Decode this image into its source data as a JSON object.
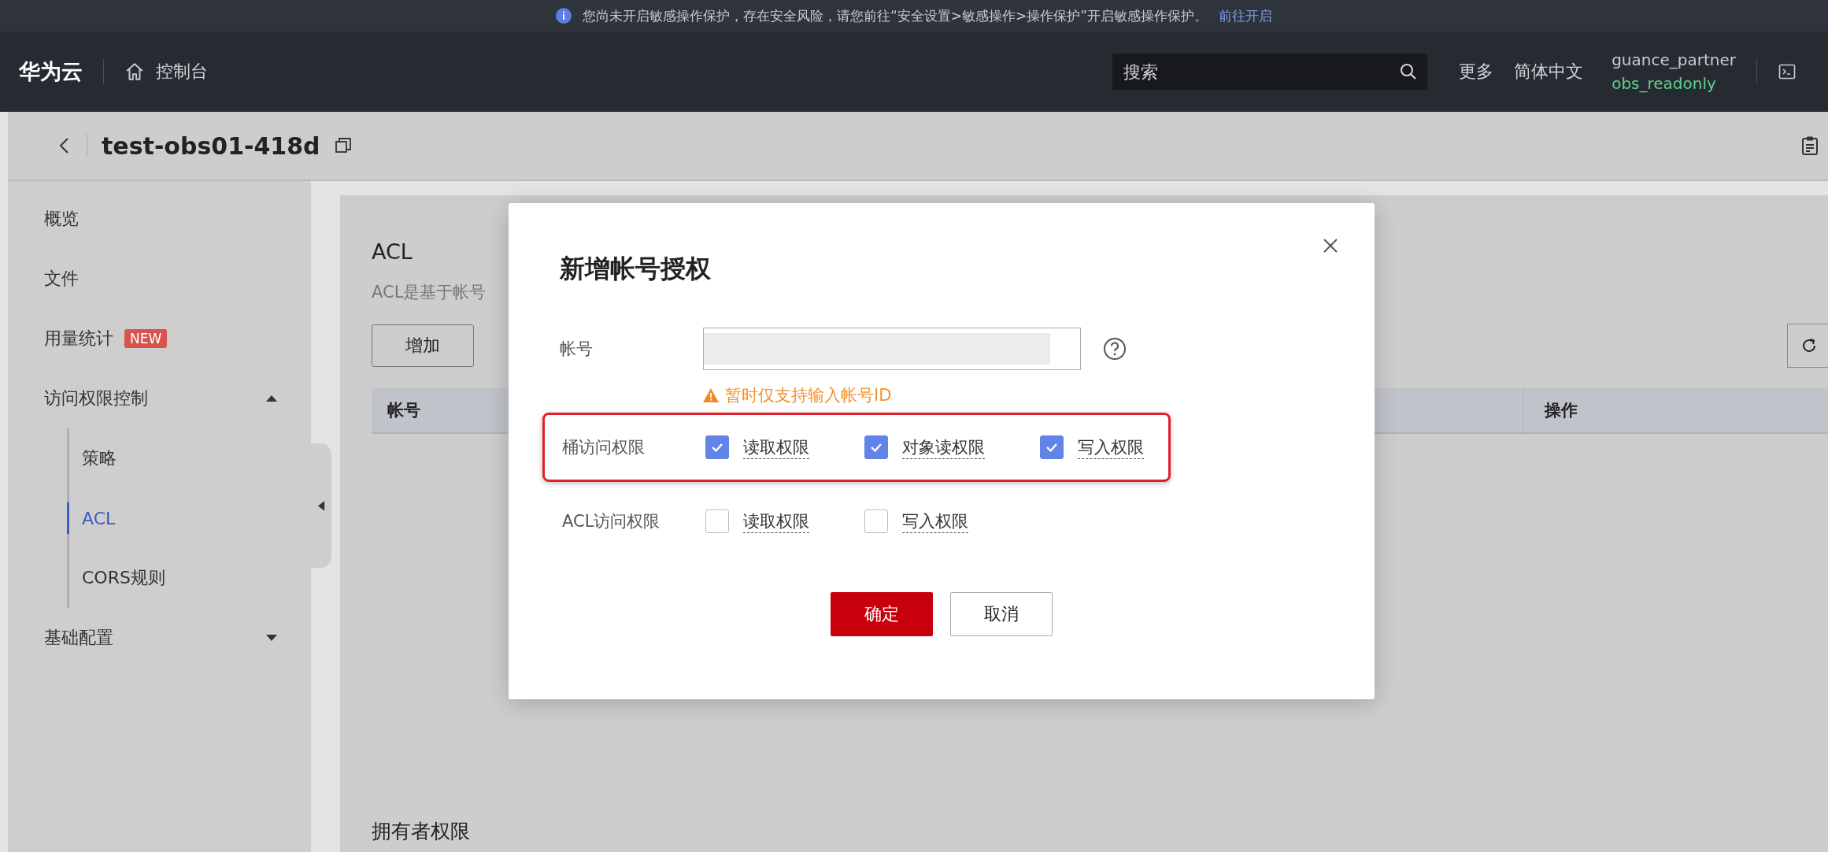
{
  "banner": {
    "message": "您尚未开启敏感操作保护，存在安全风险，请您前往“安全设置>敏感操作>操作保护”开启敏感操作保护。",
    "link": "前往开启"
  },
  "topnav": {
    "logo": "华为云",
    "console": "控制台",
    "search": {
      "placeholder": "搜索"
    },
    "more": "更多",
    "language": "简体中文",
    "user": "guance_partner",
    "role": "obs_readonly"
  },
  "header": {
    "title": "test-obs01-418d"
  },
  "sidebar": {
    "items": [
      {
        "label": "概览",
        "selected": false
      },
      {
        "label": "文件",
        "selected": false
      },
      {
        "label": "用量统计",
        "selected": false,
        "badge": "NEW"
      },
      {
        "label": "访问权限控制",
        "selected": false,
        "expanded": true,
        "children": [
          {
            "label": "策略",
            "selected": false
          },
          {
            "label": "ACL",
            "selected": true
          },
          {
            "label": "CORS规则",
            "selected": false
          }
        ]
      },
      {
        "label": "基础配置",
        "selected": false,
        "expanded": false
      }
    ]
  },
  "content": {
    "title": "ACL",
    "description": "ACL是基于帐号",
    "add_button": "增加",
    "columns": [
      "帐号",
      "操作"
    ],
    "section_title": "拥有者权限"
  },
  "dialog": {
    "title": "新增帐号授权",
    "account": {
      "label": "帐号",
      "hint": "暂时仅支持输入帐号ID"
    },
    "permission_groups": [
      {
        "label": "桶访问权限",
        "highlighted": true,
        "options": [
          {
            "label": "读取权限",
            "checked": true
          },
          {
            "label": "对象读权限",
            "checked": true
          },
          {
            "label": "写入权限",
            "checked": true
          }
        ]
      },
      {
        "label": "ACL访问权限",
        "highlighted": false,
        "options": [
          {
            "label": "读取权限",
            "checked": false
          },
          {
            "label": "写入权限",
            "checked": false
          }
        ]
      }
    ],
    "confirm": "确定",
    "cancel": "取消"
  }
}
